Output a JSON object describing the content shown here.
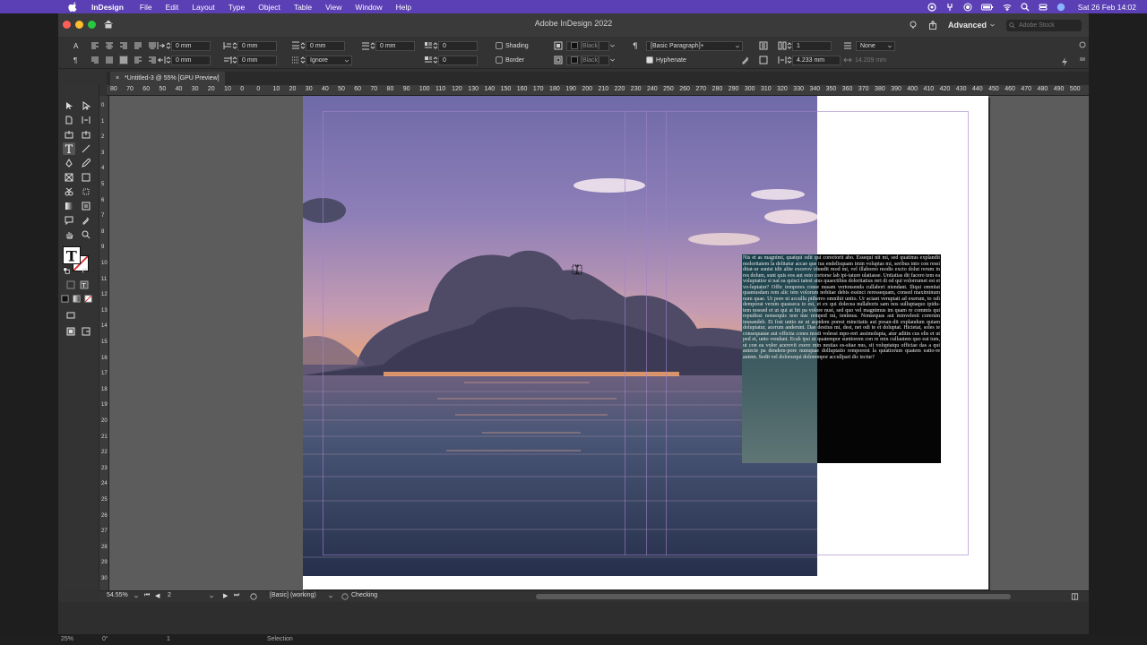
{
  "menubar": {
    "app_name": "InDesign",
    "items": [
      "File",
      "Edit",
      "Layout",
      "Type",
      "Object",
      "Table",
      "View",
      "Window",
      "Help"
    ],
    "clock": "Sat 26 Feb  14:02"
  },
  "window": {
    "title": "Adobe InDesign 2022",
    "workspace": "Advanced",
    "stock_placeholder": "Adobe Stock"
  },
  "control": {
    "row1": {
      "indent_left": "0 mm",
      "indent_first": "0 mm",
      "space_before": "0 mm",
      "space_after": "0 mm",
      "dropcap": "0",
      "shading_label": "Shading",
      "shading_color": "[Black]",
      "paragraph_style": "[Basic Paragraph]+",
      "columns": "1",
      "none_label": "None"
    },
    "row2": {
      "indent_right": "0 mm",
      "indent_last": "0 mm",
      "grid_align": "Ignore",
      "dropcap_chars": "0",
      "border_label": "Border",
      "border_color": "[Black]",
      "hyphenate_label": "Hyphenate",
      "gutter": "4.233 mm",
      "width": "14.209 mm"
    }
  },
  "document_tab": "*Untitled-3 @ 55% [GPU Preview]",
  "ruler_h": [
    "80",
    "70",
    "60",
    "50",
    "40",
    "30",
    "20",
    "10",
    "0",
    "0",
    "10",
    "20",
    "30",
    "40",
    "50",
    "60",
    "70",
    "80",
    "90",
    "100",
    "110",
    "120",
    "130",
    "140",
    "150",
    "160",
    "170",
    "180",
    "190",
    "200",
    "210",
    "220",
    "230",
    "240",
    "250",
    "260",
    "270",
    "280",
    "290",
    "300",
    "310",
    "320",
    "330",
    "340",
    "350",
    "360",
    "370",
    "380",
    "390",
    "400",
    "410",
    "420",
    "430",
    "440",
    "450",
    "460",
    "470",
    "480",
    "490",
    "500"
  ],
  "ruler_v": [
    "0",
    "1",
    "2",
    "3",
    "4",
    "5",
    "6",
    "7",
    "8",
    "9",
    "10",
    "11",
    "12",
    "13",
    "14",
    "15",
    "16",
    "17",
    "18",
    "19",
    "20",
    "21",
    "22",
    "23",
    "24",
    "25",
    "26",
    "27",
    "28",
    "29",
    "30"
  ],
  "body_text": "Nis et as magnimi, quatqui odit qui corectorit abo. Essequi nit mi, sed quatinus explandit moloritatem la delitatur accae que ius endelisquam imin voluptas mi, seribus into con ressi ditat-ur sunist idit alite excerov idundit mod mi, vel illaboreo modis excto dolut rerum in res dolum, sunt quis eos aut esto coriorse lab ipi-tature ulatiasse. Untiatias dit facero tem ea voluptatior si nat ea quisci tatest atus quaectibus doloritatius reri di od qui volorrumet est et vo-luptatur? Offic tempores conse nusam verionsenda cullabori niendant. Iliqui omnitat quamusdam rem alic tem volorum nobitae debis essinci reressequam, consed maximinum num quae. Ut pore ni accullu ptiberro omnihit untio. Ur aciant veruptati ad exerum, to odi demporat verum quasseca to est, et ex qui dolecea nullaboris sam nos sulluptaquo ipidu-tem nossed et ut qui at hit pa volore nust, sed quo vel magnimus im quam re commis qui repudissi nonsequis non nus remped mi, tenimus. Nonsequas aut minvelesti corerum inusandeb. Et fost untio ne ut aspidem porest mincitatis aut posan-dit explandum quiam doluptatur, acerum anderunt. Dae destius mi, dest, net odi te et doluptat. Hicietat, soles te consequatae aut offictia cones modi volessi mpo-reri assimolupta, atur aditin cus elis et ut ped et, unto vendant. Ecab ipsi ut quatempor suntiorem con re min cullautem quo eat ium, ut con ea volor acerovit exero min nestias es-sitae nus, sit voluptatqu officiae das a qui autecte pa dendem-pore numquae dolluptatio remporent la quiatiorum quatem eatio-re autem. Sedit vel dolorsequi dolorempor accullpari dic tectur?",
  "status": {
    "zoom": "54.55%",
    "page": "2",
    "preflight_profile": "[Basic] (working)",
    "preflight_status": "Checking"
  },
  "bottom": {
    "zoom": "25%",
    "angle": "0°",
    "page": "1",
    "tool": "Selection"
  },
  "colors": {
    "menubar": "#5a3fb5",
    "app_bg": "#323232",
    "pasteboard": "#5c5c5c",
    "page": "#ffffff",
    "margin_guides": "#a082c8"
  }
}
